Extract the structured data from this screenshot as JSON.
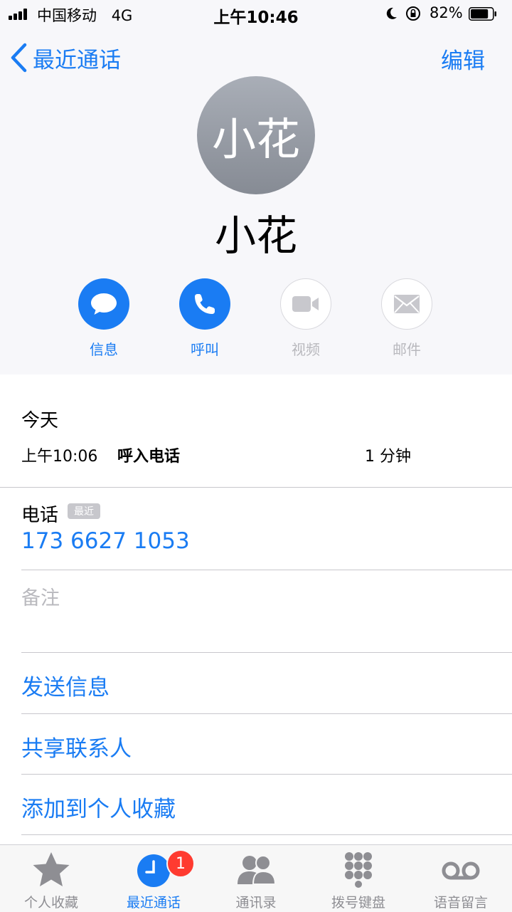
{
  "status_bar": {
    "carrier": "中国移动",
    "network": "4G",
    "time": "上午10:46",
    "battery": "82%",
    "battery_level": 0.82
  },
  "nav": {
    "back_label": "最近通话",
    "edit_label": "编辑"
  },
  "contact": {
    "avatar_text": "小花",
    "name": "小花"
  },
  "actions": [
    {
      "label": "信息",
      "icon": "message-icon",
      "enabled": true
    },
    {
      "label": "呼叫",
      "icon": "phone-icon",
      "enabled": true
    },
    {
      "label": "视频",
      "icon": "video-icon",
      "enabled": false
    },
    {
      "label": "邮件",
      "icon": "mail-icon",
      "enabled": false
    }
  ],
  "call_history": {
    "day": "今天",
    "time": "上午10:06",
    "type": "呼入电话",
    "duration": "1 分钟"
  },
  "phone": {
    "label": "电话",
    "badge": "最近",
    "number": "173 6627 1053"
  },
  "notes_label": "备注",
  "links": {
    "send_message": "发送信息",
    "share_contact": "共享联系人",
    "add_favorite": "添加到个人收藏"
  },
  "tabs": [
    {
      "label": "个人收藏",
      "icon": "star-icon",
      "active": false
    },
    {
      "label": "最近通话",
      "icon": "clock-icon",
      "active": true,
      "badge": "1"
    },
    {
      "label": "通讯录",
      "icon": "contacts-icon",
      "active": false
    },
    {
      "label": "拨号键盘",
      "icon": "keypad-icon",
      "active": false
    },
    {
      "label": "语音留言",
      "icon": "voicemail-icon",
      "active": false
    }
  ],
  "colors": {
    "accent": "#1a7cf3",
    "badge_red": "#ff3b30",
    "inactive_gray": "#8e8e93"
  }
}
